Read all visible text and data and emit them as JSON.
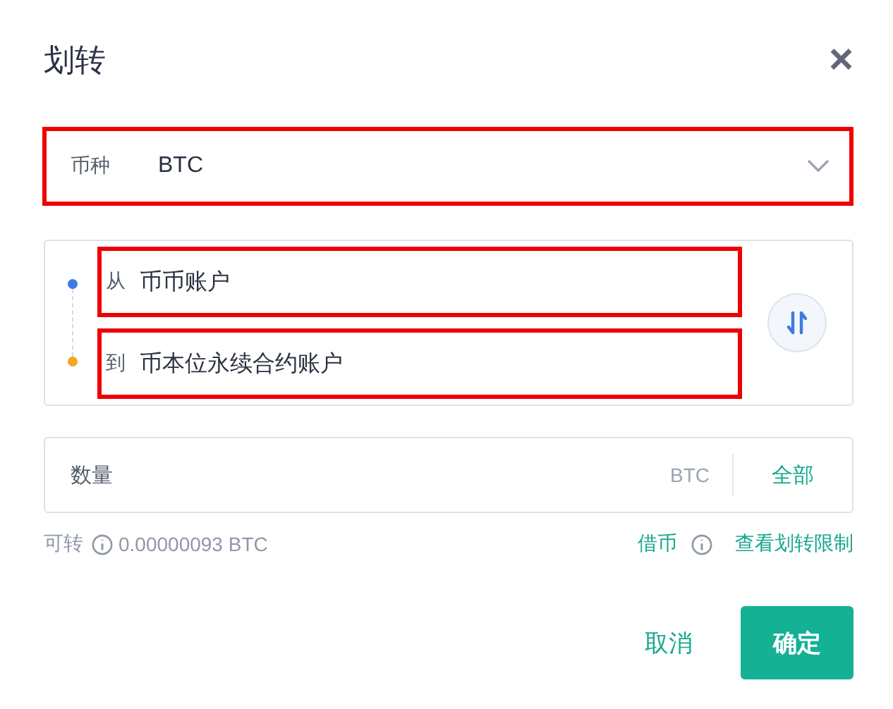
{
  "dialog": {
    "title": "划转",
    "close": "×"
  },
  "coin_select": {
    "label": "币种",
    "value": "BTC",
    "highlighted": true
  },
  "accounts": [
    {
      "kind": "from",
      "label": "从",
      "value": "币币账户",
      "highlighted": true
    },
    {
      "kind": "to",
      "label": "到",
      "value": "币本位永续合约账户",
      "highlighted": true
    }
  ],
  "amount": {
    "placeholder": "数量",
    "unit": "BTC",
    "all": "全部"
  },
  "available": {
    "label": "可转",
    "value": "0.00000093 BTC"
  },
  "links": [
    {
      "kind": "borrow",
      "label": "借币"
    },
    {
      "kind": "limits",
      "label": "查看划转限制"
    }
  ],
  "buttons": [
    {
      "kind": "cancel",
      "label": "取消"
    },
    {
      "kind": "confirm",
      "label": "确定"
    }
  ]
}
